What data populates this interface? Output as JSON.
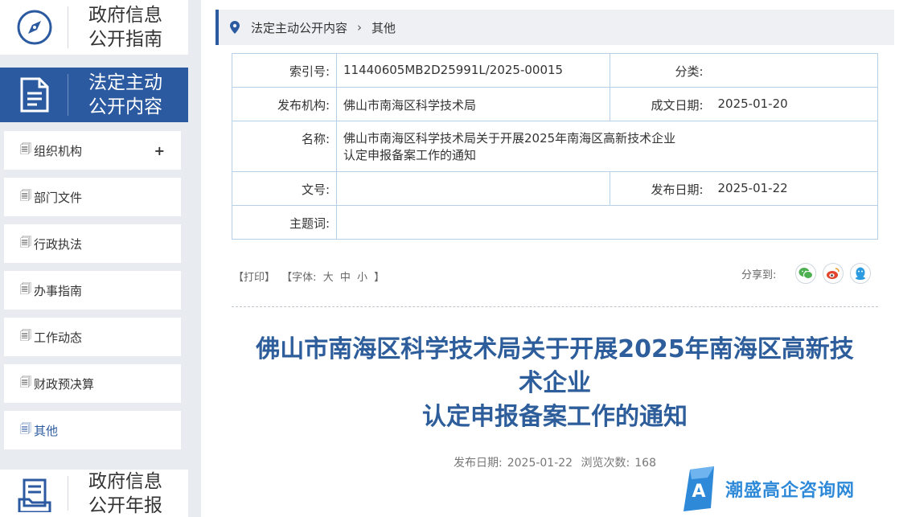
{
  "sidebar": {
    "guide": {
      "line1": "政府信息",
      "line2": "公开指南"
    },
    "active": {
      "line1": "法定主动",
      "line2": "公开内容"
    },
    "items": [
      {
        "label": "组织机构",
        "expandable": "+"
      },
      {
        "label": "部门文件"
      },
      {
        "label": "行政执法"
      },
      {
        "label": "办事指南"
      },
      {
        "label": "工作动态"
      },
      {
        "label": "财政预决算"
      },
      {
        "label": "其他"
      }
    ],
    "annual": {
      "line1": "政府信息",
      "line2": "公开年报"
    },
    "doc_glyph": "🗐"
  },
  "breadcrumb": {
    "level1": "法定主动公开内容",
    "sep": "›",
    "level2": "其他"
  },
  "meta": {
    "index_label": "索引号:",
    "index_value": "11440605MB2D25991L/2025-00015",
    "category_label": "分类:",
    "category_value": "",
    "publisher_label": "发布机构:",
    "publisher_value": "佛山市南海区科学技术局",
    "created_label": "成文日期:",
    "created_value": "2025-01-20",
    "name_label": "名称:",
    "name_line1": "佛山市南海区科学技术局关于开展2025年南海区高新技术企业",
    "name_line2": "认定申报备案工作的通知",
    "docno_label": "文号:",
    "docno_value": "",
    "pubdate_label": "发布日期:",
    "pubdate_value": "2025-01-22",
    "keyword_label": "主题词:",
    "keyword_value": ""
  },
  "tools": {
    "print": "【打印】",
    "font_open": "【字体:",
    "font_large": "大",
    "font_medium": "中",
    "font_small": "小",
    "font_close": "】"
  },
  "share": {
    "label": "分享到:"
  },
  "article": {
    "title_line1": "佛山市南海区科学技术局关于开展2025年南海区高新技",
    "title_line2": "术企业",
    "title_line3": "认定申报备案工作的通知",
    "pubdate_label": "发布日期:",
    "pubdate_value": "2025-01-22",
    "views_label": "浏览次数:",
    "views_value": "168"
  },
  "watermark": {
    "text": "潮盛高企咨询网",
    "logo_letter": "A"
  },
  "colors": {
    "primary": "#2c5aa0",
    "title": "#2d5d9a",
    "table_border": "#b5d0e8",
    "wechat": "#4caf50",
    "weibo": "#e2452c",
    "qq": "#2c9be0",
    "watermark": "#2e8ad8"
  }
}
